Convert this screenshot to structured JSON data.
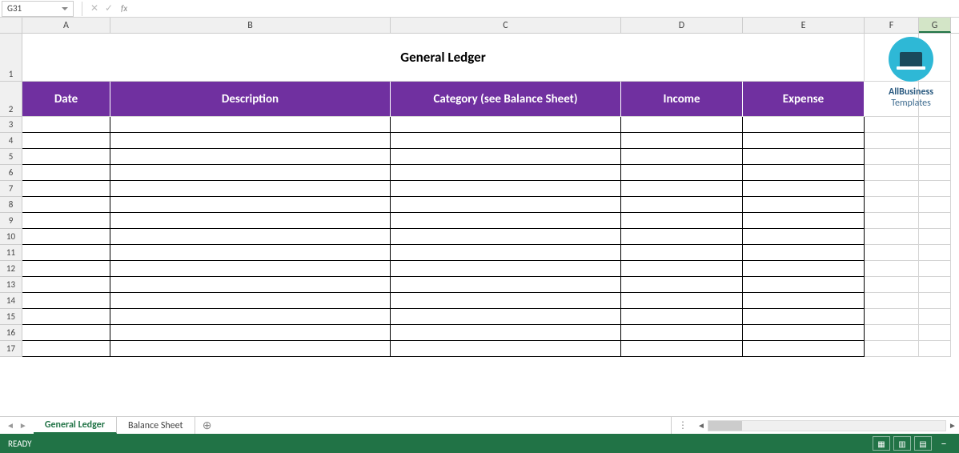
{
  "formula_bar": {
    "cell_ref": "G31",
    "fx_label": "fx"
  },
  "columns": [
    {
      "letter": "A",
      "class": "cA"
    },
    {
      "letter": "B",
      "class": "cB"
    },
    {
      "letter": "C",
      "class": "cC"
    },
    {
      "letter": "D",
      "class": "cD"
    },
    {
      "letter": "E",
      "class": "cE"
    },
    {
      "letter": "F",
      "class": "cF"
    },
    {
      "letter": "G",
      "class": "cG",
      "selected": true
    }
  ],
  "title": "General Ledger",
  "ledger_headers": [
    "Date",
    "Description",
    "Category (see Balance Sheet)",
    "Income",
    "Expense"
  ],
  "data_row_start": 3,
  "data_row_end": 17,
  "watermark": {
    "line1": "AllBusiness",
    "line2": "Templates"
  },
  "sheets": [
    {
      "name": "General Ledger",
      "active": true
    },
    {
      "name": "Balance Sheet",
      "active": false
    }
  ],
  "status": {
    "ready": "READY"
  }
}
